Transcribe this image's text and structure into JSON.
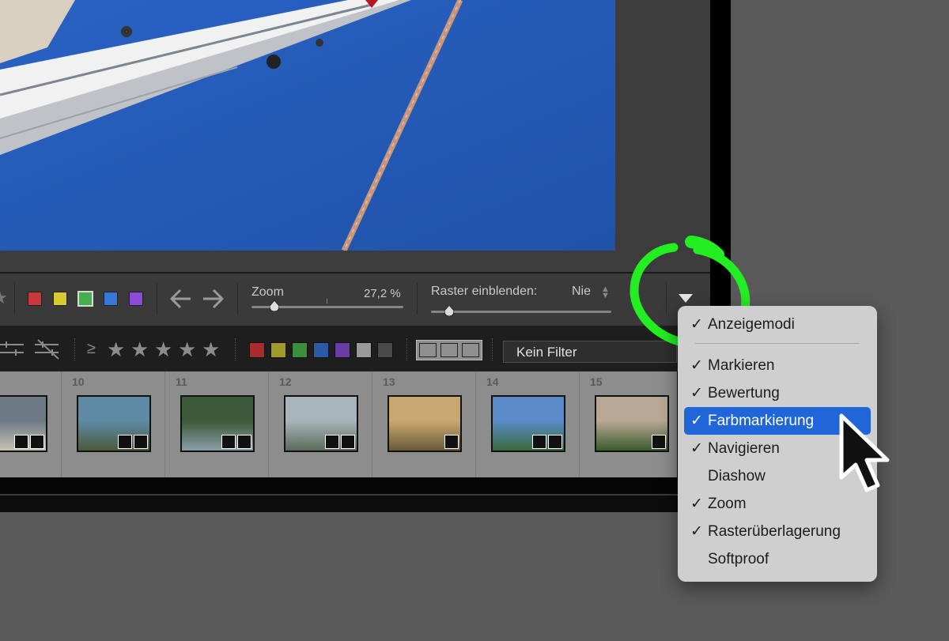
{
  "toolbar": {
    "color_labels": [
      "#c83a3a",
      "#d8c832",
      "#47ad4d",
      "#3a78d8",
      "#8c4ad6"
    ],
    "selected_color_index": 2,
    "zoom_label": "Zoom",
    "zoom_value": "27,2 %",
    "zoom_fraction": 0.15,
    "grid_label": "Raster einblenden:",
    "grid_value": "Nie",
    "grid_fraction": 0.1
  },
  "filterbar": {
    "rating_operator": "≥",
    "star_count": 5,
    "color_filters": [
      "#a82c2c",
      "#a09a28",
      "#3a8e3c",
      "#2c5aa8",
      "#6a3ca8",
      "#9a9a9a",
      "#4a4a4a"
    ],
    "filter_value": "Kein Filter"
  },
  "filmstrip": {
    "cells": [
      {
        "number": "",
        "badges": 2
      },
      {
        "number": "10",
        "badges": 2
      },
      {
        "number": "11",
        "badges": 2
      },
      {
        "number": "12",
        "badges": 2
      },
      {
        "number": "13",
        "badges": 1
      },
      {
        "number": "14",
        "badges": 2
      },
      {
        "number": "15",
        "badges": 1
      }
    ]
  },
  "menu": {
    "items": [
      {
        "label": "Anzeigemodi",
        "checked": true
      },
      {
        "label": "Markieren",
        "checked": true
      },
      {
        "label": "Bewertung",
        "checked": true
      },
      {
        "label": "Farbmarkierung",
        "checked": true,
        "highlighted": true
      },
      {
        "label": "Navigieren",
        "checked": true
      },
      {
        "label": "Diashow",
        "checked": false
      },
      {
        "label": "Zoom",
        "checked": true
      },
      {
        "label": "Rasterüberlagerung",
        "checked": true
      },
      {
        "label": "Softproof",
        "checked": false
      }
    ],
    "check_glyph": "✓"
  },
  "annotation_color": "#22ee22"
}
